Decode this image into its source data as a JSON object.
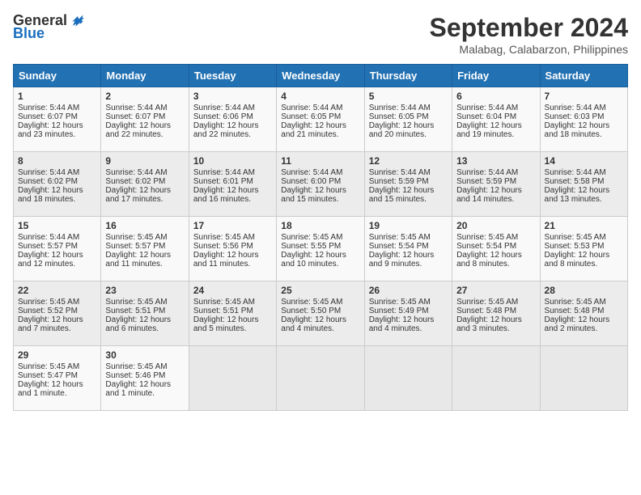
{
  "header": {
    "logo_general": "General",
    "logo_blue": "Blue",
    "month": "September 2024",
    "location": "Malabag, Calabarzon, Philippines"
  },
  "weekdays": [
    "Sunday",
    "Monday",
    "Tuesday",
    "Wednesday",
    "Thursday",
    "Friday",
    "Saturday"
  ],
  "weeks": [
    [
      {
        "day": "1",
        "lines": [
          "Sunrise: 5:44 AM",
          "Sunset: 6:07 PM",
          "Daylight: 12 hours",
          "and 23 minutes."
        ]
      },
      {
        "day": "2",
        "lines": [
          "Sunrise: 5:44 AM",
          "Sunset: 6:07 PM",
          "Daylight: 12 hours",
          "and 22 minutes."
        ]
      },
      {
        "day": "3",
        "lines": [
          "Sunrise: 5:44 AM",
          "Sunset: 6:06 PM",
          "Daylight: 12 hours",
          "and 22 minutes."
        ]
      },
      {
        "day": "4",
        "lines": [
          "Sunrise: 5:44 AM",
          "Sunset: 6:05 PM",
          "Daylight: 12 hours",
          "and 21 minutes."
        ]
      },
      {
        "day": "5",
        "lines": [
          "Sunrise: 5:44 AM",
          "Sunset: 6:05 PM",
          "Daylight: 12 hours",
          "and 20 minutes."
        ]
      },
      {
        "day": "6",
        "lines": [
          "Sunrise: 5:44 AM",
          "Sunset: 6:04 PM",
          "Daylight: 12 hours",
          "and 19 minutes."
        ]
      },
      {
        "day": "7",
        "lines": [
          "Sunrise: 5:44 AM",
          "Sunset: 6:03 PM",
          "Daylight: 12 hours",
          "and 18 minutes."
        ]
      }
    ],
    [
      {
        "day": "8",
        "lines": [
          "Sunrise: 5:44 AM",
          "Sunset: 6:02 PM",
          "Daylight: 12 hours",
          "and 18 minutes."
        ]
      },
      {
        "day": "9",
        "lines": [
          "Sunrise: 5:44 AM",
          "Sunset: 6:02 PM",
          "Daylight: 12 hours",
          "and 17 minutes."
        ]
      },
      {
        "day": "10",
        "lines": [
          "Sunrise: 5:44 AM",
          "Sunset: 6:01 PM",
          "Daylight: 12 hours",
          "and 16 minutes."
        ]
      },
      {
        "day": "11",
        "lines": [
          "Sunrise: 5:44 AM",
          "Sunset: 6:00 PM",
          "Daylight: 12 hours",
          "and 15 minutes."
        ]
      },
      {
        "day": "12",
        "lines": [
          "Sunrise: 5:44 AM",
          "Sunset: 5:59 PM",
          "Daylight: 12 hours",
          "and 15 minutes."
        ]
      },
      {
        "day": "13",
        "lines": [
          "Sunrise: 5:44 AM",
          "Sunset: 5:59 PM",
          "Daylight: 12 hours",
          "and 14 minutes."
        ]
      },
      {
        "day": "14",
        "lines": [
          "Sunrise: 5:44 AM",
          "Sunset: 5:58 PM",
          "Daylight: 12 hours",
          "and 13 minutes."
        ]
      }
    ],
    [
      {
        "day": "15",
        "lines": [
          "Sunrise: 5:44 AM",
          "Sunset: 5:57 PM",
          "Daylight: 12 hours",
          "and 12 minutes."
        ]
      },
      {
        "day": "16",
        "lines": [
          "Sunrise: 5:45 AM",
          "Sunset: 5:57 PM",
          "Daylight: 12 hours",
          "and 11 minutes."
        ]
      },
      {
        "day": "17",
        "lines": [
          "Sunrise: 5:45 AM",
          "Sunset: 5:56 PM",
          "Daylight: 12 hours",
          "and 11 minutes."
        ]
      },
      {
        "day": "18",
        "lines": [
          "Sunrise: 5:45 AM",
          "Sunset: 5:55 PM",
          "Daylight: 12 hours",
          "and 10 minutes."
        ]
      },
      {
        "day": "19",
        "lines": [
          "Sunrise: 5:45 AM",
          "Sunset: 5:54 PM",
          "Daylight: 12 hours",
          "and 9 minutes."
        ]
      },
      {
        "day": "20",
        "lines": [
          "Sunrise: 5:45 AM",
          "Sunset: 5:54 PM",
          "Daylight: 12 hours",
          "and 8 minutes."
        ]
      },
      {
        "day": "21",
        "lines": [
          "Sunrise: 5:45 AM",
          "Sunset: 5:53 PM",
          "Daylight: 12 hours",
          "and 8 minutes."
        ]
      }
    ],
    [
      {
        "day": "22",
        "lines": [
          "Sunrise: 5:45 AM",
          "Sunset: 5:52 PM",
          "Daylight: 12 hours",
          "and 7 minutes."
        ]
      },
      {
        "day": "23",
        "lines": [
          "Sunrise: 5:45 AM",
          "Sunset: 5:51 PM",
          "Daylight: 12 hours",
          "and 6 minutes."
        ]
      },
      {
        "day": "24",
        "lines": [
          "Sunrise: 5:45 AM",
          "Sunset: 5:51 PM",
          "Daylight: 12 hours",
          "and 5 minutes."
        ]
      },
      {
        "day": "25",
        "lines": [
          "Sunrise: 5:45 AM",
          "Sunset: 5:50 PM",
          "Daylight: 12 hours",
          "and 4 minutes."
        ]
      },
      {
        "day": "26",
        "lines": [
          "Sunrise: 5:45 AM",
          "Sunset: 5:49 PM",
          "Daylight: 12 hours",
          "and 4 minutes."
        ]
      },
      {
        "day": "27",
        "lines": [
          "Sunrise: 5:45 AM",
          "Sunset: 5:48 PM",
          "Daylight: 12 hours",
          "and 3 minutes."
        ]
      },
      {
        "day": "28",
        "lines": [
          "Sunrise: 5:45 AM",
          "Sunset: 5:48 PM",
          "Daylight: 12 hours",
          "and 2 minutes."
        ]
      }
    ],
    [
      {
        "day": "29",
        "lines": [
          "Sunrise: 5:45 AM",
          "Sunset: 5:47 PM",
          "Daylight: 12 hours",
          "and 1 minute."
        ]
      },
      {
        "day": "30",
        "lines": [
          "Sunrise: 5:45 AM",
          "Sunset: 5:46 PM",
          "Daylight: 12 hours",
          "and 1 minute."
        ]
      },
      {
        "day": "",
        "lines": []
      },
      {
        "day": "",
        "lines": []
      },
      {
        "day": "",
        "lines": []
      },
      {
        "day": "",
        "lines": []
      },
      {
        "day": "",
        "lines": []
      }
    ]
  ]
}
